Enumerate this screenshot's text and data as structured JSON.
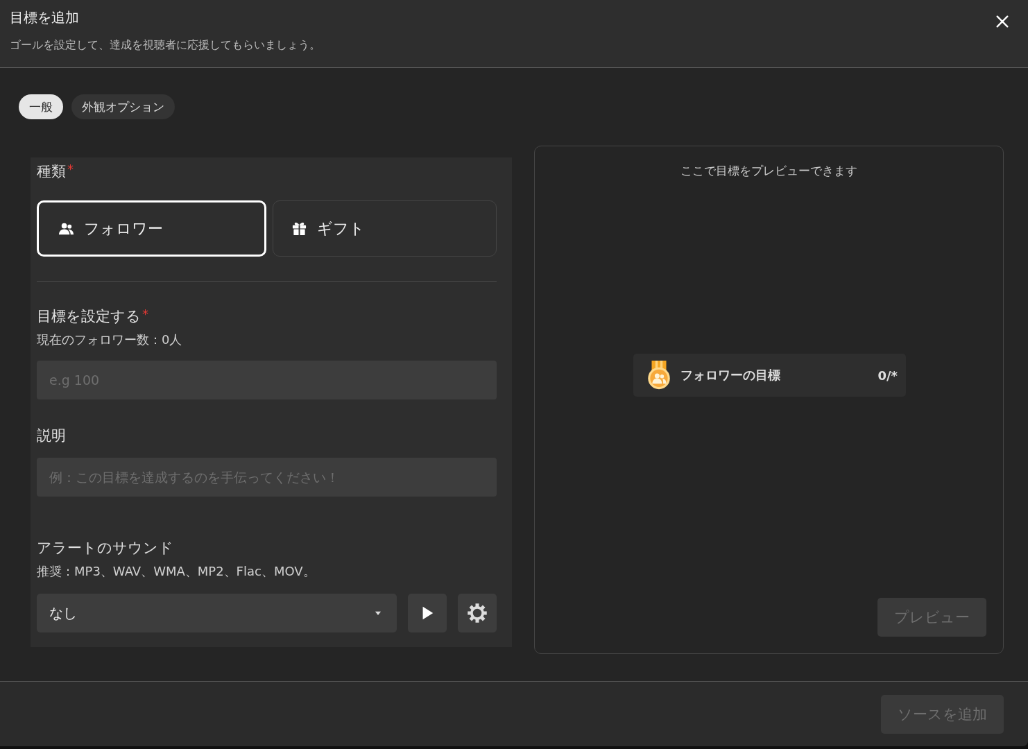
{
  "dialog": {
    "title": "目標を追加",
    "subtitle": "ゴールを設定して、達成を視聴者に応援してもらいましょう。"
  },
  "tabs": [
    {
      "label": "一般",
      "selected": true
    },
    {
      "label": "外観オプション",
      "selected": false
    }
  ],
  "form": {
    "type_field": {
      "label": "種類",
      "required_mark": "*"
    },
    "types": [
      {
        "label": "フォロワー",
        "kind": "people",
        "selected": true
      },
      {
        "label": "ギフト",
        "kind": "gift",
        "selected": false
      }
    ],
    "goal": {
      "label": "目標を設定する",
      "required_mark": "*",
      "current": "現在のフォロワー数：0人",
      "placeholder": "e.g 100"
    },
    "description": {
      "label": "説明",
      "placeholder": "例：この目標を達成するのを手伝ってください！"
    },
    "sound": {
      "label": "アラートのサウンド",
      "hint": "推奨：MP3、WAV、WMA、MP2、Flac、MOV。",
      "value": "なし"
    }
  },
  "preview": {
    "hint": "ここで目標をプレビューできます",
    "widget": {
      "title": "フォロワーの目標",
      "count": "0/*"
    },
    "button": {
      "label": "プレビュー",
      "disabled": true
    }
  },
  "footer": {
    "button": {
      "label": "ソースを追加",
      "disabled": true
    }
  }
}
